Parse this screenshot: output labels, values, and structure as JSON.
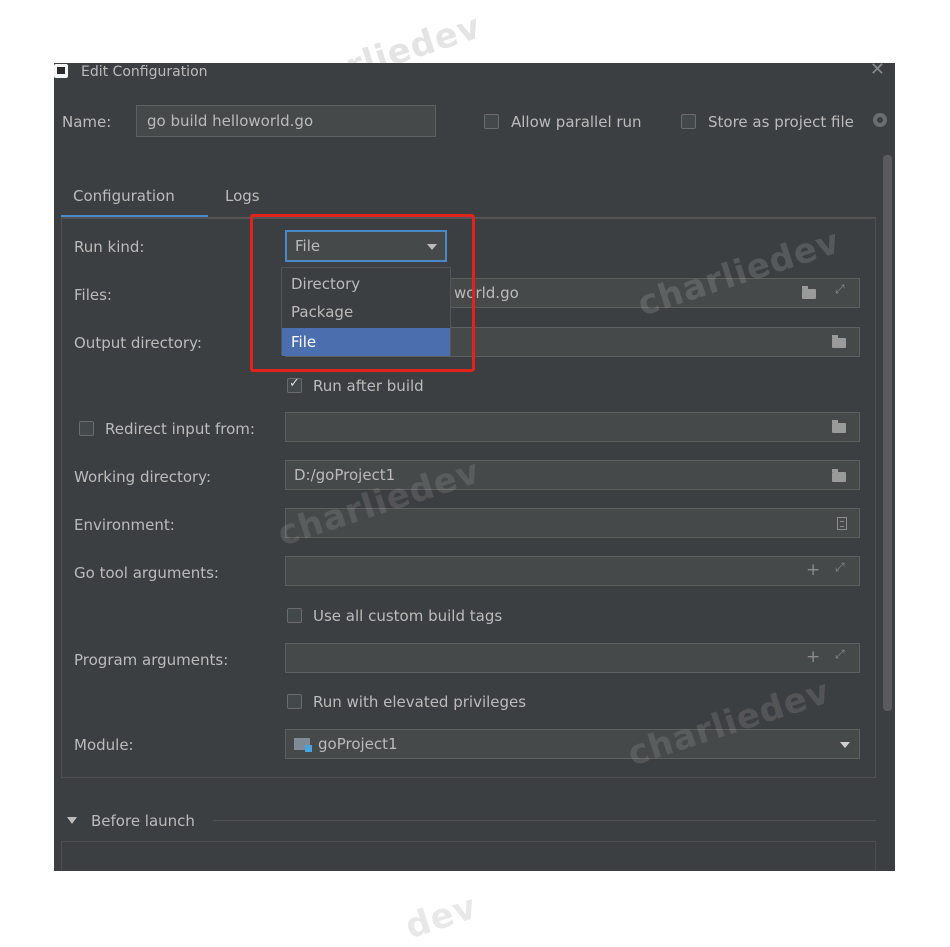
{
  "watermark": "charliedev",
  "watermark_bottom": "dev",
  "dialog": {
    "title": "Edit Configuration",
    "close": "✕"
  },
  "name_row": {
    "label": "Name:",
    "value": "go build helloworld.go",
    "allow_parallel": "Allow parallel run",
    "store_project": "Store as project file"
  },
  "tabs": [
    "Configuration",
    "Logs"
  ],
  "form": {
    "run_kind_label": "Run kind:",
    "run_kind_value": "File",
    "files_label": "Files:",
    "files_value": "world.go",
    "output_label": "Output directory:",
    "run_after_build": "Run after build",
    "redirect_label": "Redirect input from:",
    "working_label": "Working directory:",
    "working_value": "D:/goProject1",
    "environment_label": "Environment:",
    "go_tool_label": "Go tool arguments:",
    "use_custom_tags": "Use all custom build tags",
    "program_args_label": "Program arguments:",
    "elevated": "Run with elevated privileges",
    "module_label": "Module:",
    "module_value": "goProject1"
  },
  "dropdown_options": [
    "Directory",
    "Package",
    "File"
  ],
  "before_launch": "Before launch",
  "colors": {
    "accent": "#4a88c7",
    "selection": "#4b6eaf",
    "highlight": "#e1241b",
    "panel": "#3c3f41"
  }
}
